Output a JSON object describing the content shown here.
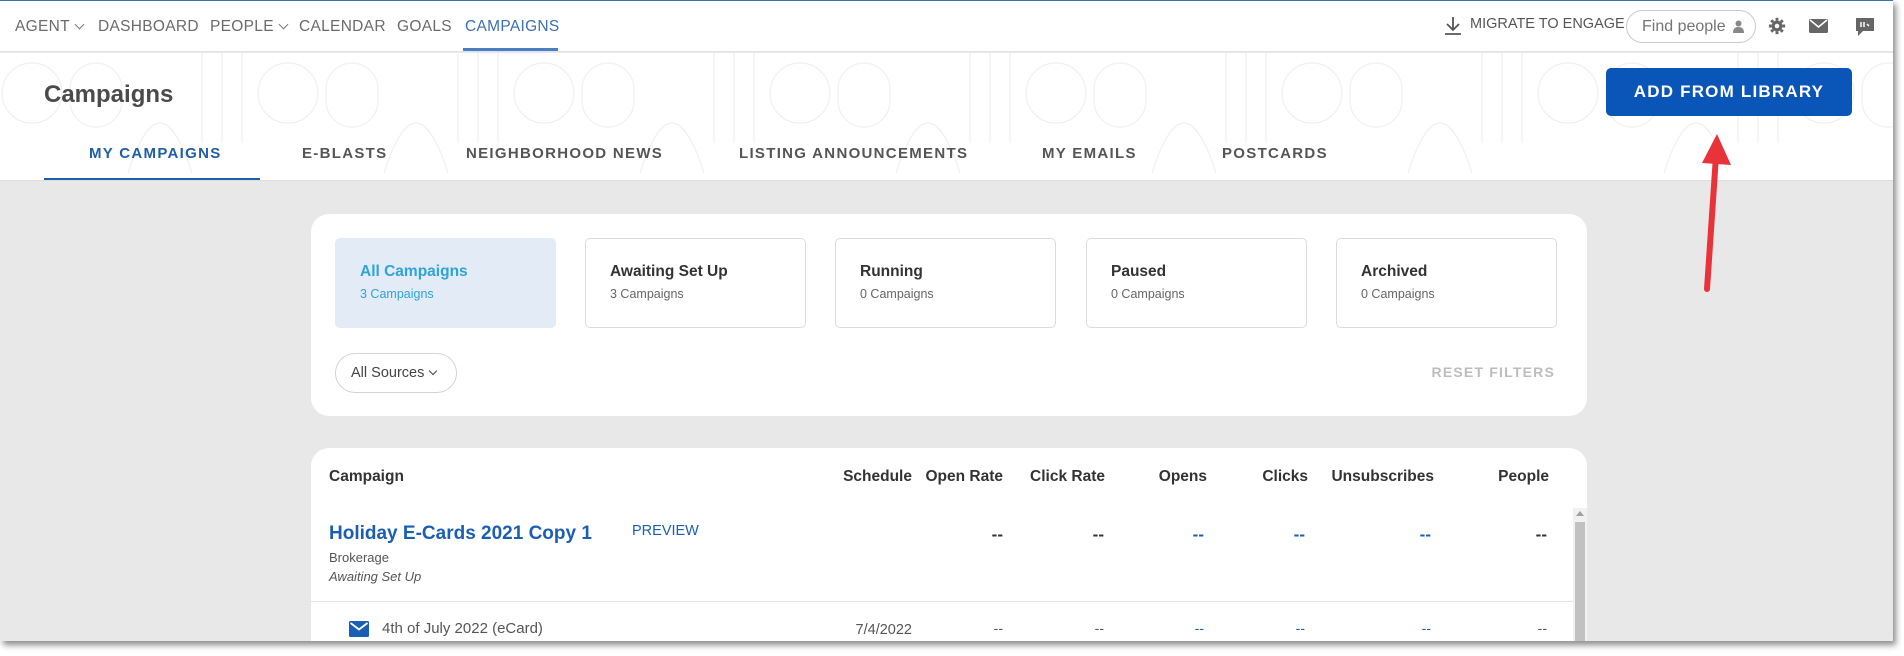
{
  "nav": {
    "items": [
      {
        "label": "AGENT",
        "has_menu": true
      },
      {
        "label": "DASHBOARD",
        "has_menu": false
      },
      {
        "label": "PEOPLE",
        "has_menu": true
      },
      {
        "label": "CALENDAR",
        "has_menu": false
      },
      {
        "label": "GOALS",
        "has_menu": false
      },
      {
        "label": "CAMPAIGNS",
        "has_menu": false,
        "active": true
      }
    ],
    "migrate_label": "MIGRATE TO ENGAGE",
    "search_placeholder": "Find people",
    "icons": [
      "download-icon",
      "person-icon",
      "gear-icon",
      "mail-icon",
      "chat-icon"
    ]
  },
  "header": {
    "title": "Campaigns",
    "add_button": "ADD FROM LIBRARY",
    "tabs": [
      "MY CAMPAIGNS",
      "E-BLASTS",
      "NEIGHBORHOOD NEWS",
      "LISTING ANNOUNCEMENTS",
      "MY EMAILS",
      "POSTCARDS"
    ],
    "active_tab": "MY CAMPAIGNS"
  },
  "filters": {
    "statuses": [
      {
        "name": "All Campaigns",
        "count": "3 Campaigns",
        "active": true
      },
      {
        "name": "Awaiting Set Up",
        "count": "3 Campaigns"
      },
      {
        "name": "Running",
        "count": "0 Campaigns"
      },
      {
        "name": "Paused",
        "count": "0 Campaigns"
      },
      {
        "name": "Archived",
        "count": "0 Campaigns"
      }
    ],
    "sources_label": "All Sources",
    "reset_label": "RESET FILTERS"
  },
  "table": {
    "columns": [
      "Campaign",
      "Schedule",
      "Open Rate",
      "Click Rate",
      "Opens",
      "Clicks",
      "Unsubscribes",
      "People"
    ],
    "campaign": {
      "name": "Holiday E-Cards 2021 Copy 1",
      "preview": "PREVIEW",
      "source": "Brokerage",
      "status": "Awaiting Set Up",
      "metrics": {
        "open_rate": "--",
        "click_rate": "--",
        "opens": "--",
        "clicks": "--",
        "unsubscribes": "--",
        "people": "--"
      }
    },
    "email": {
      "name": "4th of July 2022 (eCard)",
      "schedule": "7/4/2022",
      "metrics": {
        "open_rate": "--",
        "click_rate": "--",
        "opens": "--",
        "clicks": "--",
        "unsubscribes": "--",
        "people": "--"
      }
    }
  },
  "colors": {
    "primary": "#0a55b8",
    "link": "#1a5fb4",
    "active_status_bg": "#e2ebf6",
    "active_status_text": "#2ea3dc",
    "annotation_arrow": "#e8333a"
  }
}
